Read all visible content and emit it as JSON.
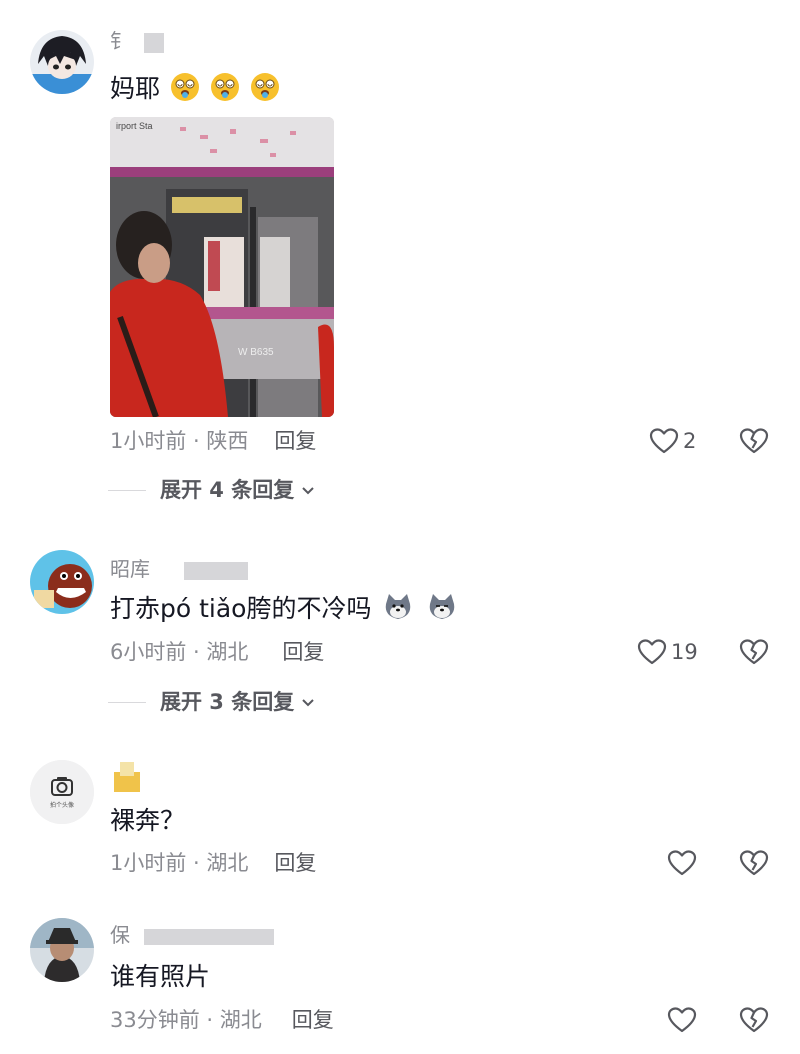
{
  "comments": [
    {
      "username": "钅",
      "text": "妈耶",
      "emoji_icon": "tongue-spinning-face-emoji",
      "photo_sign": "irport Sta",
      "photo_car_no": "W  B635",
      "time_location": "1小时前 · 陕西",
      "reply_label": "回复",
      "likes": "2",
      "expand_label": "展开 4 条回复"
    },
    {
      "username": "昭库",
      "text": "打赤pó tiǎo胯的不冷吗",
      "emoji_icon": "husky-dog-emoji",
      "time_location": "6小时前 · 湖北",
      "reply_label": "回复",
      "likes": "19",
      "expand_label": "展开 3 条回复"
    },
    {
      "username": "",
      "text": "裸奔？",
      "avatar_caption": "拍个头像",
      "time_location": "1小时前 · 湖北",
      "reply_label": "回复",
      "likes": ""
    },
    {
      "username": "保",
      "text": "谁有照片",
      "time_location": "33分钟前 · 湖北",
      "reply_label": "回复",
      "likes": ""
    }
  ],
  "colors": {
    "primary_text": "#161823",
    "secondary_text": "#8a8b91",
    "icon": "#57585e",
    "jacket_red": "#c8271e",
    "metro_purple": "#b0508a"
  }
}
